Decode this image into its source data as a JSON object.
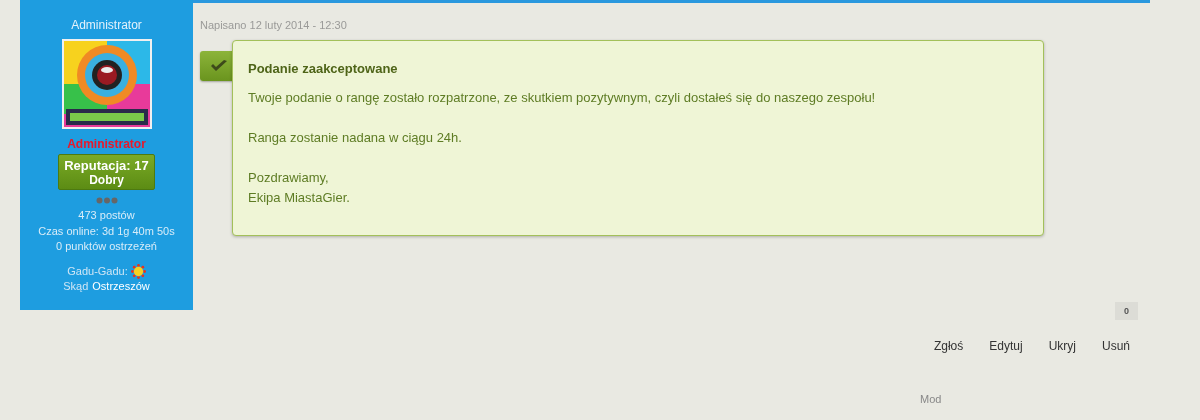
{
  "sidebar": {
    "username": "Administrator",
    "group": "Administrator",
    "reputation": {
      "label": "Reputacja: 17",
      "rank": "Dobry"
    },
    "stats": [
      "473 postów",
      "Czas online: 3d 1g 40m 50s",
      "0 punktów ostrzeżeń"
    ],
    "gadu_label": "Gadu-Gadu:",
    "location_label": "Skąd",
    "location": "Ostrzeszów"
  },
  "post": {
    "date": "Napisano 12 luty 2014 - 12:30",
    "message": {
      "title": "Podanie zaakceptowane",
      "paragraphs": [
        [
          "Twoje podanie o rangę zostało rozpatrzone, ze skutkiem pozytywnym, czyli dostałeś się do naszego zespołu!"
        ],
        [
          "Ranga zostanie nadana w ciągu 24h."
        ],
        [
          "Pozdrawiamy,",
          "Ekipa MiastaGier."
        ]
      ]
    },
    "likes_count": "0",
    "actions": [
      "Zgłoś",
      "Edytuj",
      "Ukryj",
      "Usuń"
    ],
    "moderation_label": "Mod"
  }
}
